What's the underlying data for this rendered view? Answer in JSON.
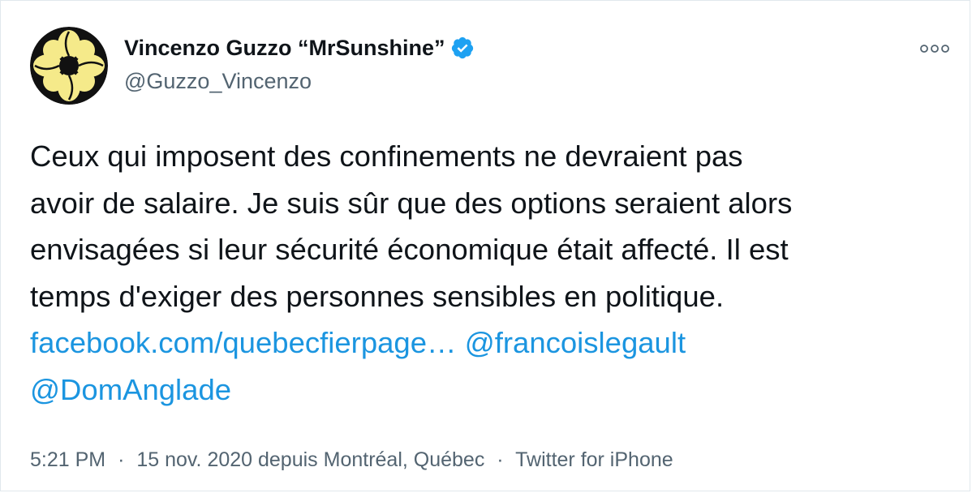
{
  "tweet": {
    "author": {
      "display_name": "Vincenzo Guzzo “MrSunshine”",
      "handle": "@Guzzo_Vincenzo",
      "verified_icon": "verified-badge-icon",
      "avatar_icon": "yellow-flower-avatar"
    },
    "more_icon": "more-options-icon",
    "text_lines": [
      "Ceux qui imposent des confinements ne devraient pas",
      "avoir de salaire. Je suis sûr que des options seraient alors",
      "envisagées si leur sécurité économique était affecté. Il est",
      "temps d'exiger des personnes sensibles en politique."
    ],
    "links": {
      "url": "facebook.com/quebecfierpage…",
      "mention_1": "@francoislegault",
      "mention_2": "@DomAnglade"
    },
    "meta": {
      "time": "5:21 PM",
      "separator": "·",
      "date_location": "15 nov. 2020 depuis Montréal, Québec",
      "source": "Twitter for iPhone"
    }
  },
  "colors": {
    "link": "#1b95e0",
    "muted": "#536471",
    "verified": "#1da1f2",
    "avatar_petal": "#f5ea8a",
    "avatar_bg": "#111111"
  }
}
